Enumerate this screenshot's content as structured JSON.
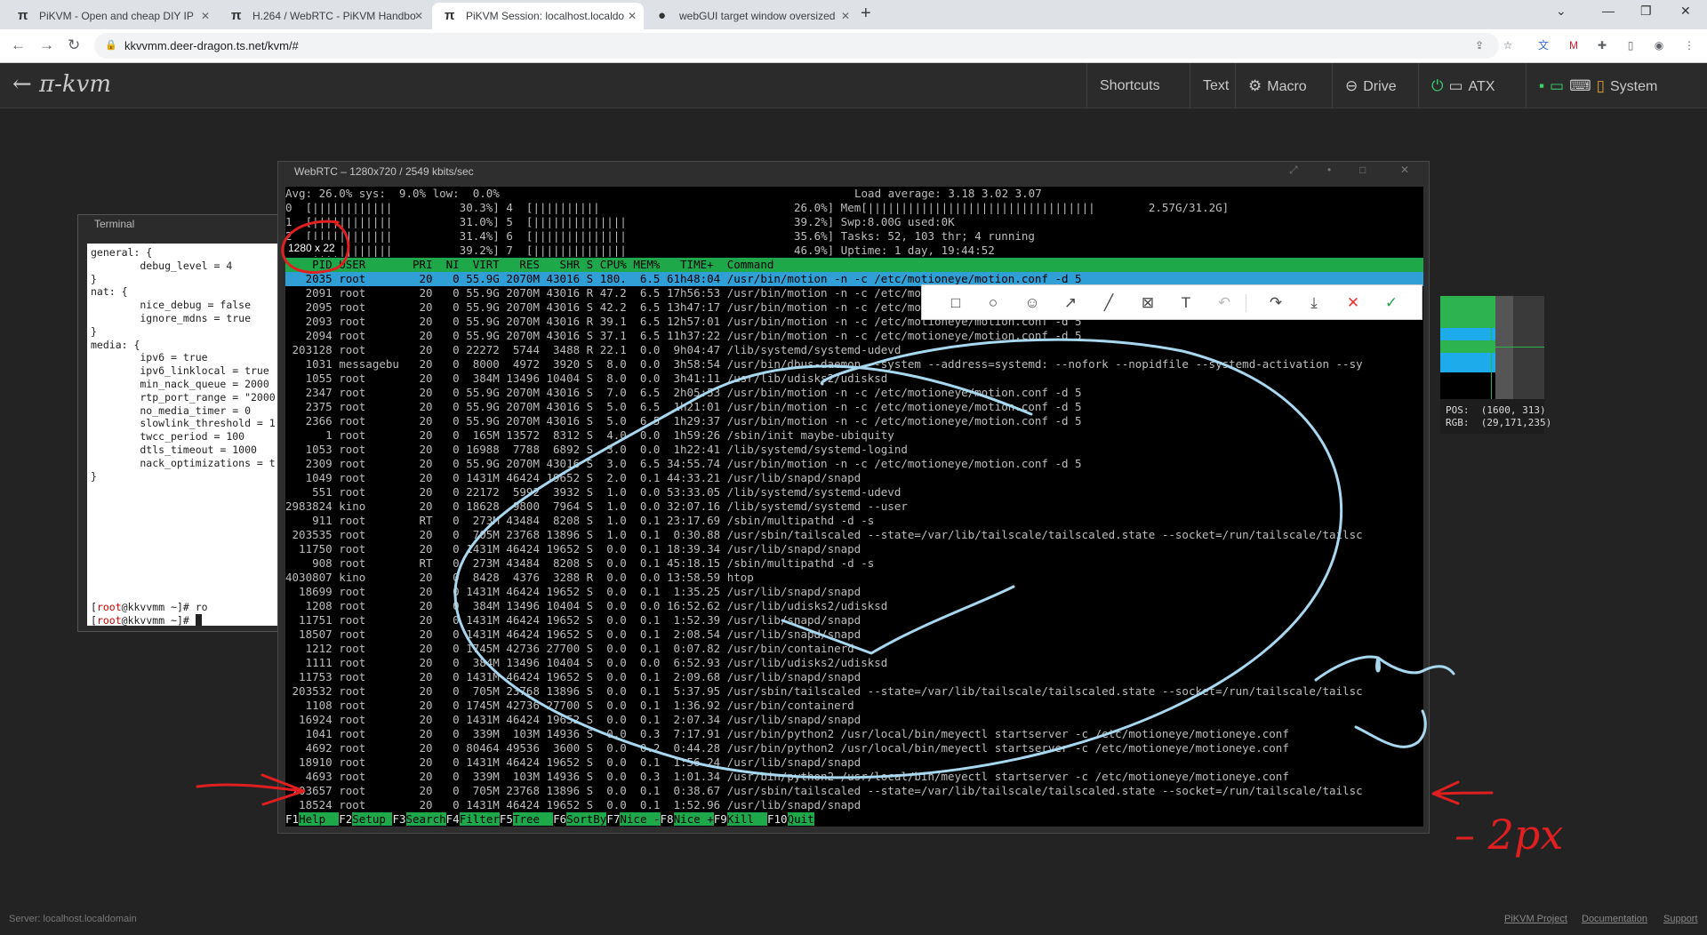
{
  "browser": {
    "tabs": [
      {
        "title": "PiKVM - Open and cheap DIY IP",
        "favicon": "pi-icon"
      },
      {
        "title": "H.264 / WebRTC - PiKVM Handbo",
        "favicon": "pi-icon"
      },
      {
        "title": "PiKVM Session: localhost.localdo",
        "favicon": "pi-icon"
      },
      {
        "title": "webGUI target window oversized",
        "favicon": "github-icon"
      }
    ],
    "new_tab": "+",
    "url": "kkvvmm.deer-dragon.ts.net/kvm/#"
  },
  "kvm_header": {
    "logo": "← π-kvm",
    "menu": [
      "Shortcuts",
      "Text",
      "Macro",
      "Drive",
      "ATX",
      "System"
    ]
  },
  "terminal": {
    "title": "Terminal",
    "lines": [
      "general: {",
      "        debug_level = 4",
      "}",
      "nat: {",
      "        nice_debug = false",
      "        ignore_mdns = true",
      "}",
      "media: {",
      "        ipv6 = true",
      "        ipv6_linklocal = true",
      "        min_nack_queue = 2000",
      "        rtp_port_range = \"2000",
      "        no_media_timer = 0",
      "        slowlink_threshold = 1",
      "        twcc_period = 100",
      "        dtls_timeout = 1000",
      "        nack_optimizations = t",
      "}"
    ],
    "prompt1_user": "root",
    "prompt1_host": "kkvvmm",
    "prompt1_cmd": "ro",
    "prompt2_user": "root",
    "prompt2_host": "kkvvmm"
  },
  "webrtc": {
    "title": "WebRTC – 1280x720 / 2549 kbits/sec",
    "size_badge": "1280 x 22"
  },
  "htop": {
    "header_left": [
      "Avg: 26.0% sys:  9.0% low:  0.0%",
      "0  [||||||||||||          30.3%] 4  [||||||||||",
      "1  [||||||||||||          31.0%] 5  [||||||||||||||",
      "2  [||||||||||||          31.4%] 6  [||||||||||||||",
      "3  [||||||||||||          39.2%] 7  [||||||||||||||"
    ],
    "header_right": [
      "Load average: 3.18 3.02 3.07",
      "26.0%] Mem[||||||||||||||||||||||||||||||||||        2.57G/31.2G]",
      "39.2%] Swp:8.00G used:0K",
      "35.6%] Tasks: 52, 103 thr; 4 running",
      "46.9%] Uptime: 1 day, 19:44:52"
    ],
    "columns": "    PID USER       PRI  NI  VIRT   RES   SHR S CPU% MEM%   TIME+  Command",
    "rows": [
      "   2035 root        20   0 55.9G 2070M 43016 S 180.  6.5 61h48:04 /usr/bin/motion -n -c /etc/motioneye/motion.conf -d 5",
      "   2091 root        20   0 55.9G 2070M 43016 R 47.2  6.5 17h56:53 /usr/bin/motion -n -c /etc/motioneye/motion.conf -d 5",
      "   2095 root        20   0 55.9G 2070M 43016 S 42.2  6.5 13h47:17 /usr/bin/motion -n -c /etc/motioneye/motion.conf -d 5",
      "   2093 root        20   0 55.9G 2070M 43016 R 39.1  6.5 12h57:01 /usr/bin/motion -n -c /etc/motioneye/motion.conf -d 5",
      "   2094 root        20   0 55.9G 2070M 43016 S 37.1  6.5 11h37:22 /usr/bin/motion -n -c /etc/motioneye/motion.conf -d 5",
      " 203128 root        20   0 22272  5744  3488 R 22.1  0.0  9h04:47 /lib/systemd/systemd-udevd",
      "   1031 messagebu   20   0  8000  4972  3920 S  8.0  0.0  3h58:54 /usr/bin/dbus-daemon --system --address=systemd: --nofork --nopidfile --systemd-activation --sy",
      "   1055 root        20   0  384M 13496 10404 S  8.0  0.0  3h41:11 /usr/lib/udisks2/udisksd",
      "   2347 root        20   0 55.9G 2070M 43016 S  7.0  6.5  2h05:53 /usr/bin/motion -n -c /etc/motioneye/motion.conf -d 5",
      "   2375 root        20   0 55.9G 2070M 43016 S  5.0  6.5  1h21:01 /usr/bin/motion -n -c /etc/motioneye/motion.conf -d 5",
      "   2366 root        20   0 55.9G 2070M 43016 S  5.0  6.5  1h29:37 /usr/bin/motion -n -c /etc/motioneye/motion.conf -d 5",
      "      1 root        20   0  165M 13572  8312 S  4.0  0.0  1h59:26 /sbin/init maybe-ubiquity",
      "   1053 root        20   0 16988  7788  6892 S  3.0  0.0  1h22:41 /lib/systemd/systemd-logind",
      "   2309 root        20   0 55.9G 2070M 43016 S  3.0  6.5 34:55.74 /usr/bin/motion -n -c /etc/motioneye/motion.conf -d 5",
      "   1049 root        20   0 1431M 46424 19652 S  2.0  0.1 44:33.21 /usr/lib/snapd/snapd",
      "    551 root        20   0 22172  5992  3932 S  1.0  0.0 53:33.05 /lib/systemd/systemd-udevd",
      "2983824 kino        20   0 18628  9800  7964 S  1.0  0.0 32:07.16 /lib/systemd/systemd --user",
      "    911 root        RT   0  273M 43484  8208 S  1.0  0.1 23:17.69 /sbin/multipathd -d -s",
      " 203535 root        20   0  705M 23768 13896 S  1.0  0.1  0:30.88 /usr/sbin/tailscaled --state=/var/lib/tailscale/tailscaled.state --socket=/run/tailscale/tailsc",
      "  11750 root        20   0 1431M 46424 19652 S  0.0  0.1 18:39.34 /usr/lib/snapd/snapd",
      "    908 root        RT   0  273M 43484  8208 S  0.0  0.1 45:18.15 /sbin/multipathd -d -s",
      "4030807 kino        20   0  8428  4376  3288 R  0.0  0.0 13:58.59 htop",
      "  18699 root        20   0 1431M 46424 19652 S  0.0  0.1  1:35.25 /usr/lib/snapd/snapd",
      "   1208 root        20   0  384M 13496 10404 S  0.0  0.0 16:52.62 /usr/lib/udisks2/udisksd",
      "  11751 root        20   0 1431M 46424 19652 S  0.0  0.1  1:52.39 /usr/lib/snapd/snapd",
      "  18507 root        20   0 1431M 46424 19652 S  0.0  0.1  2:08.54 /usr/lib/snapd/snapd",
      "   1212 root        20   0 1745M 42736 27700 S  0.0  0.1  0:07.82 /usr/bin/containerd",
      "   1111 root        20   0  384M 13496 10404 S  0.0  0.0  6:52.93 /usr/lib/udisks2/udisksd",
      "  11753 root        20   0 1431M 46424 19652 S  0.0  0.1  2:09.68 /usr/lib/snapd/snapd",
      " 203532 root        20   0  705M 23768 13896 S  0.0  0.1  5:37.95 /usr/sbin/tailscaled --state=/var/lib/tailscale/tailscaled.state --socket=/run/tailscale/tailsc",
      "   1108 root        20   0 1745M 42736 27700 S  0.0  0.1  1:36.92 /usr/bin/containerd",
      "  16924 root        20   0 1431M 46424 19652 S  0.0  0.1  2:07.34 /usr/lib/snapd/snapd",
      "   1041 root        20   0  339M  103M 14936 S  0.0  0.3  7:17.91 /usr/bin/python2 /usr/local/bin/meyectl startserver -c /etc/motioneye/motioneye.conf",
      "   4692 root        20   0 80464 49536  3600 S  0.0  0.2  0:44.28 /usr/bin/python2 /usr/local/bin/meyectl startserver -c /etc/motioneye/motioneye.conf",
      "  18910 root        20   0 1431M 46424 19652 S  0.0  0.1  1:56.24 /usr/lib/snapd/snapd",
      "   4693 root        20   0  339M  103M 14936 S  0.0  0.3  1:01.34 /usr/bin/python2 /usr/local/bin/meyectl startserver -c /etc/motioneye/motioneye.conf",
      " 203657 root        20   0  705M 23768 13896 S  0.0  0.1  0:38.67 /usr/sbin/tailscaled --state=/var/lib/tailscale/tailscaled.state --socket=/run/tailscale/tailsc",
      "  18524 root        20   0 1431M 46424 19652 S  0.0  0.1  1:52.96 /usr/lib/snapd/snapd"
    ],
    "fkeys": [
      {
        "key": "F1",
        "label": "Help  "
      },
      {
        "key": "F2",
        "label": "Setup "
      },
      {
        "key": "F3",
        "label": "Search"
      },
      {
        "key": "F4",
        "label": "Filter"
      },
      {
        "key": "F5",
        "label": "Tree  "
      },
      {
        "key": "F6",
        "label": "SortBy"
      },
      {
        "key": "F7",
        "label": "Nice -"
      },
      {
        "key": "F8",
        "label": "Nice +"
      },
      {
        "key": "F9",
        "label": "Kill  "
      },
      {
        "key": "F10",
        "label": "Quit"
      }
    ]
  },
  "annotation_toolbar": {
    "tools": [
      "rectangle-icon",
      "circle-icon",
      "emoji-icon",
      "arrow-icon",
      "line-icon",
      "blur-icon",
      "text-icon",
      "undo-icon",
      "share-icon",
      "download-icon",
      "cancel-icon",
      "confirm-icon"
    ]
  },
  "color_picker": {
    "pos": "POS:  (1600, 313)",
    "rgb": "RGB:  (29,171,235)"
  },
  "annotation": {
    "note": "– 2px",
    "stroke_color": "#9fd6ef",
    "arrow_color": "#e02020"
  },
  "footer": {
    "server": "Server: localhost.localdomain",
    "links": [
      "PiKVM Project",
      "Documentation",
      "Support"
    ]
  }
}
